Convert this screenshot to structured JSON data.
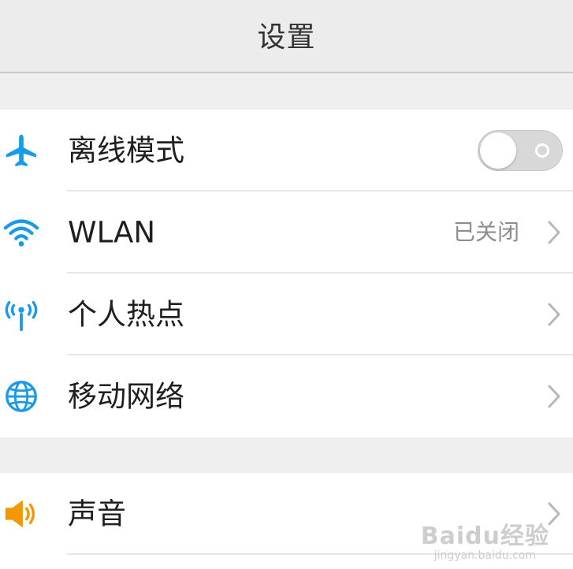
{
  "header": {
    "title": "设置"
  },
  "groups": [
    {
      "items": [
        {
          "label": "离线模式",
          "icon": "airplane-icon",
          "control": "toggle",
          "toggle_on": false
        },
        {
          "label": "WLAN",
          "icon": "wifi-icon",
          "status": "已关闭",
          "control": "chevron"
        },
        {
          "label": "个人热点",
          "icon": "hotspot-icon",
          "control": "chevron"
        },
        {
          "label": "移动网络",
          "icon": "globe-icon",
          "control": "chevron"
        }
      ]
    },
    {
      "items": [
        {
          "label": "声音",
          "icon": "speaker-icon",
          "control": "chevron"
        }
      ]
    }
  ],
  "watermark": {
    "main": "Baidu经验",
    "sub": "jingyan.baidu.com"
  },
  "colors": {
    "accent_blue": "#1a9bea",
    "speaker_orange": "#f39800",
    "background": "#efefef",
    "row_background": "#ffffff"
  }
}
